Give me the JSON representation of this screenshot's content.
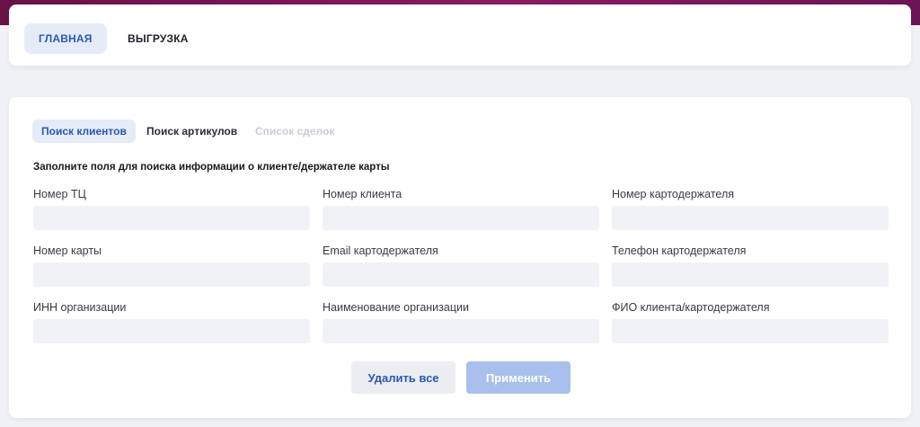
{
  "nav": {
    "tabs": [
      {
        "label": "ГЛАВНАЯ",
        "active": true
      },
      {
        "label": "ВЫГРУЗКА",
        "active": false
      }
    ]
  },
  "search": {
    "tabs": [
      {
        "label": "Поиск клиентов",
        "state": "active"
      },
      {
        "label": "Поиск артикулов",
        "state": "normal"
      },
      {
        "label": "Список сделок",
        "state": "disabled"
      }
    ],
    "form_title": "Заполните поля для поиска информации о клиенте/держателе карты",
    "fields": [
      {
        "label": "Номер ТЦ",
        "value": "",
        "placeholder": ""
      },
      {
        "label": "Номер клиента",
        "value": "",
        "placeholder": ""
      },
      {
        "label": "Номер картодержателя",
        "value": "",
        "placeholder": ""
      },
      {
        "label": "Номер карты",
        "value": "",
        "placeholder": ""
      },
      {
        "label": "Email картодержателя",
        "value": "",
        "placeholder": ""
      },
      {
        "label": "Телефон картодержателя",
        "value": "",
        "placeholder": ""
      },
      {
        "label": "ИНН организации",
        "value": "",
        "placeholder": ""
      },
      {
        "label": "Наименование организации",
        "value": "",
        "placeholder": ""
      },
      {
        "label": "ФИО клиента/картодержателя",
        "value": "",
        "placeholder": ""
      }
    ],
    "buttons": {
      "clear_label": "Удалить все",
      "apply_label": "Применить"
    }
  },
  "colors": {
    "accent": "#2a57b4",
    "active_tab_bg": "#e6ecf7",
    "header_gradient_start": "#6a1148",
    "apply_button_disabled": "#a9c0ee"
  }
}
